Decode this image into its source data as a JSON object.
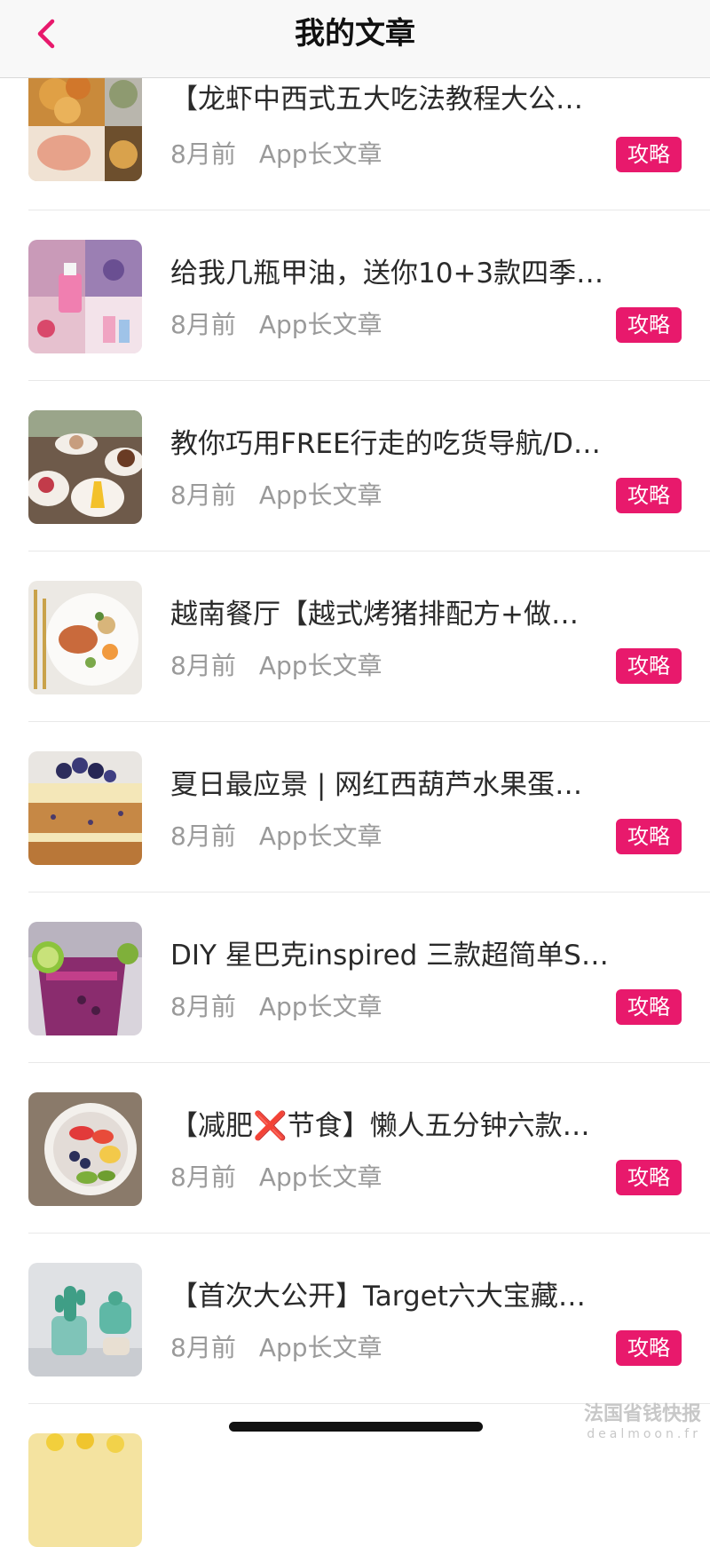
{
  "header": {
    "title": "我的文章",
    "back_icon": "chevron-left-icon",
    "accent": "#e8196c"
  },
  "articles": [
    {
      "title": "【龙虾中西式五大吃法教程大公…",
      "time": "8月前",
      "source": "App长文章",
      "tag": "攻略",
      "thumb": "food-platter-thumbnail"
    },
    {
      "title": "给我几瓶甲油，送你10+3款四季…",
      "time": "8月前",
      "source": "App长文章",
      "tag": "攻略",
      "thumb": "nail-polish-thumbnail"
    },
    {
      "title": "教你巧用FREE行走的吃货导航/D…",
      "time": "8月前",
      "source": "App长文章",
      "tag": "攻略",
      "thumb": "dessert-plates-thumbnail"
    },
    {
      "title": "越南餐厅【越式烤猪排配方+做…",
      "time": "8月前",
      "source": "App长文章",
      "tag": "攻略",
      "thumb": "vietnamese-dish-thumbnail"
    },
    {
      "title": "夏日最应景 | 网红西葫芦水果蛋…",
      "time": "8月前",
      "source": "App长文章",
      "tag": "攻略",
      "thumb": "zucchini-cake-thumbnail"
    },
    {
      "title": "DIY 星巴克inspired 三款超简单S…",
      "time": "8月前",
      "source": "App长文章",
      "tag": "攻略",
      "thumb": "berry-drink-thumbnail"
    },
    {
      "title": "【减肥❌节食】懒人五分钟六款…",
      "time": "8月前",
      "source": "App长文章",
      "tag": "攻略",
      "thumb": "fruit-bowl-thumbnail"
    },
    {
      "title": "【首次大公开】Target六大宝藏…",
      "time": "8月前",
      "source": "App长文章",
      "tag": "攻略",
      "thumb": "cactus-decor-thumbnail"
    }
  ],
  "watermark": {
    "line1": "法国省钱快报",
    "line2": "dealmoon.fr"
  }
}
